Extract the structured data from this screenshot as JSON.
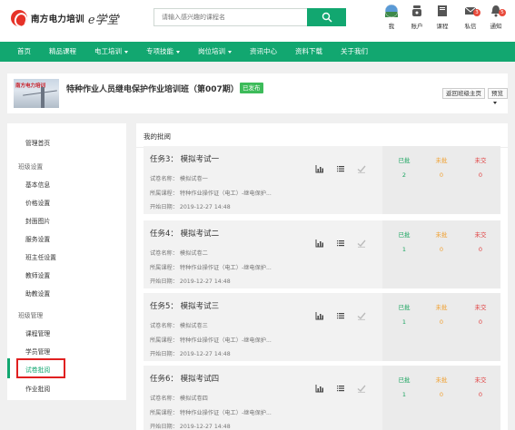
{
  "header": {
    "logo_cn": "南方电力培训",
    "logo_en": "e学堂",
    "search_placeholder": "请输入感兴趣的课程名",
    "icons": [
      {
        "name": "avatar-icon",
        "label": "我",
        "badge": ""
      },
      {
        "name": "wallet-icon",
        "label": "账户",
        "badge": ""
      },
      {
        "name": "book-icon",
        "label": "课程",
        "badge": ""
      },
      {
        "name": "mail-icon",
        "label": "私信",
        "badge": "3"
      },
      {
        "name": "bell-icon",
        "label": "通知",
        "badge": "5"
      }
    ]
  },
  "nav": {
    "items": [
      {
        "label": "首页",
        "dropdown": false
      },
      {
        "label": "精品课程",
        "dropdown": false
      },
      {
        "label": "电工培训",
        "dropdown": true
      },
      {
        "label": "专项技能",
        "dropdown": true
      },
      {
        "label": "岗位培训",
        "dropdown": true
      },
      {
        "label": "资讯中心",
        "dropdown": false
      },
      {
        "label": "资料下载",
        "dropdown": false
      },
      {
        "label": "关于我们",
        "dropdown": false
      }
    ]
  },
  "course": {
    "thumb_text": "南方电力培训",
    "title": "特种作业人员继电保护作业培训班（第007期）",
    "status": "已发布",
    "back_label": "返回班级主页",
    "preview_label": "预览"
  },
  "sidebar": {
    "items": [
      {
        "label": "管理首页",
        "type": "item"
      },
      {
        "label": "班级设置",
        "type": "group"
      },
      {
        "label": "基本信息",
        "type": "item"
      },
      {
        "label": "价格设置",
        "type": "item"
      },
      {
        "label": "封面图片",
        "type": "item"
      },
      {
        "label": "服务设置",
        "type": "item"
      },
      {
        "label": "班主任设置",
        "type": "item"
      },
      {
        "label": "教师设置",
        "type": "item"
      },
      {
        "label": "助教设置",
        "type": "item"
      },
      {
        "label": "班级管理",
        "type": "group"
      },
      {
        "label": "课程管理",
        "type": "item"
      },
      {
        "label": "学员管理",
        "type": "item"
      },
      {
        "label": "试卷批阅",
        "type": "item",
        "active": true
      },
      {
        "label": "作业批阅",
        "type": "item"
      }
    ]
  },
  "main": {
    "title": "我的批阅",
    "stat_labels": {
      "done": "已批",
      "pending": "未批",
      "none": "未交"
    },
    "tasks": [
      {
        "title": "任务3： 模拟考试一",
        "paper": "试卷名称： 模拟试卷一",
        "course": "所属课程： 特种作业操作证（电工）-继电保护...",
        "date": "开始日期： 2019-12-27 14:48",
        "done": "2",
        "pending": "0",
        "none": "0"
      },
      {
        "title": "任务4： 模拟考试二",
        "paper": "试卷名称： 模拟试卷二",
        "course": "所属课程： 特种作业操作证（电工）-继电保护...",
        "date": "开始日期： 2019-12-27 14:48",
        "done": "1",
        "pending": "0",
        "none": "0"
      },
      {
        "title": "任务5： 模拟考试三",
        "paper": "试卷名称： 模拟试卷三",
        "course": "所属课程： 特种作业操作证（电工）-继电保护...",
        "date": "开始日期： 2019-12-27 14:48",
        "done": "1",
        "pending": "0",
        "none": "0"
      },
      {
        "title": "任务6： 模拟考试四",
        "paper": "试卷名称： 模拟试卷四",
        "course": "所属课程： 特种作业操作证（电工）-继电保护...",
        "date": "开始日期： 2019-12-27 14:48",
        "done": "1",
        "pending": "0",
        "none": "0"
      }
    ]
  },
  "colors": {
    "brand": "#12a770",
    "done": "#1ba560",
    "pending": "#f0a030",
    "none": "#e04040",
    "badge": "#e84b3c"
  }
}
